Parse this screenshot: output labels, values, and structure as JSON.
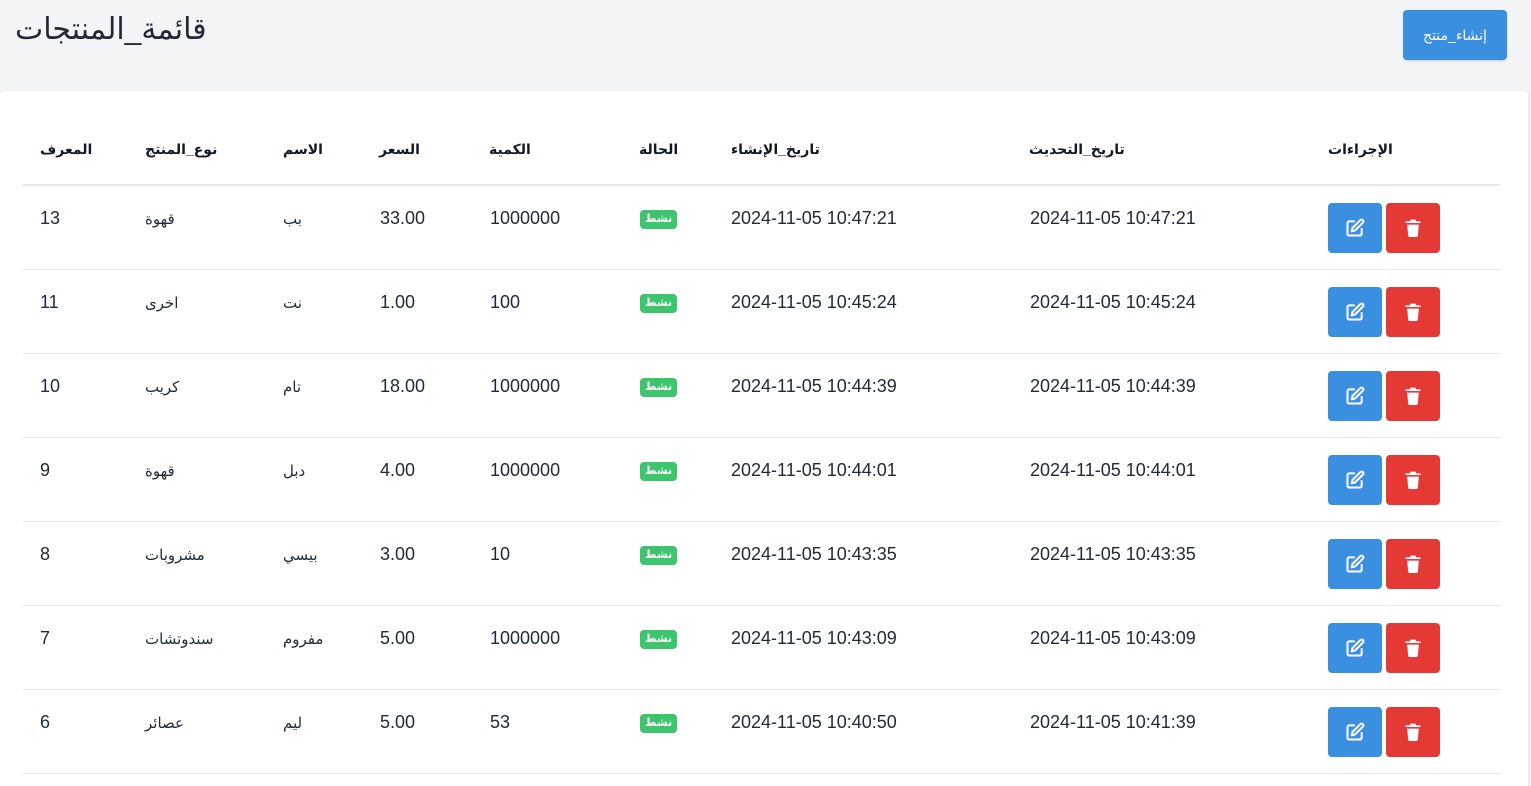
{
  "header": {
    "title": "قائمة_المنتجات",
    "create_label": "إنشاء_منتج"
  },
  "table": {
    "headers": {
      "id": "المعرف",
      "type": "نوع_المنتج",
      "name": "الاسم",
      "price": "السعر",
      "quantity": "الكمية",
      "status": "الحالة",
      "created": "تاريخ_الإنشاء",
      "updated": "تاريخ_التحديث",
      "actions": "الإجراءات"
    },
    "rows": [
      {
        "id": "13",
        "type": "قهوة",
        "name": "بب",
        "price": "33.00",
        "quantity": "1000000",
        "status": "نشط",
        "created": "2024-11-05 10:47:21",
        "updated": "2024-11-05 10:47:21"
      },
      {
        "id": "11",
        "type": "اخرى",
        "name": "نت",
        "price": "1.00",
        "quantity": "100",
        "status": "نشط",
        "created": "2024-11-05 10:45:24",
        "updated": "2024-11-05 10:45:24"
      },
      {
        "id": "10",
        "type": "كريب",
        "name": "تام",
        "price": "18.00",
        "quantity": "1000000",
        "status": "نشط",
        "created": "2024-11-05 10:44:39",
        "updated": "2024-11-05 10:44:39"
      },
      {
        "id": "9",
        "type": "قهوة",
        "name": "دبل",
        "price": "4.00",
        "quantity": "1000000",
        "status": "نشط",
        "created": "2024-11-05 10:44:01",
        "updated": "2024-11-05 10:44:01"
      },
      {
        "id": "8",
        "type": "مشروبات",
        "name": "بيسي",
        "price": "3.00",
        "quantity": "10",
        "status": "نشط",
        "created": "2024-11-05 10:43:35",
        "updated": "2024-11-05 10:43:35"
      },
      {
        "id": "7",
        "type": "سندوتشات",
        "name": "مفروم",
        "price": "5.00",
        "quantity": "1000000",
        "status": "نشط",
        "created": "2024-11-05 10:43:09",
        "updated": "2024-11-05 10:43:09"
      },
      {
        "id": "6",
        "type": "عصائر",
        "name": "ليم",
        "price": "5.00",
        "quantity": "53",
        "status": "نشط",
        "created": "2024-11-05 10:40:50",
        "updated": "2024-11-05 10:41:39"
      }
    ]
  },
  "icons": {
    "edit": "edit-icon",
    "delete": "trash-icon"
  },
  "colors": {
    "primary": "#3b8fe0",
    "danger": "#e53935",
    "success": "#3ec46d"
  }
}
